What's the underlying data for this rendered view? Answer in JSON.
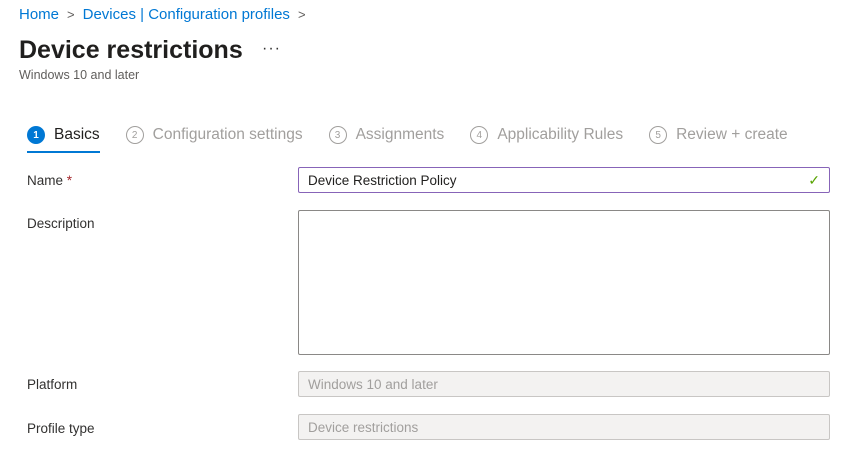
{
  "breadcrumb": {
    "home": "Home",
    "devices": "Devices | Configuration profiles",
    "sep": ">"
  },
  "header": {
    "title": "Device restrictions",
    "more": "···",
    "subtitle": "Windows 10 and later"
  },
  "steps": [
    {
      "num": "1",
      "label": "Basics"
    },
    {
      "num": "2",
      "label": "Configuration settings"
    },
    {
      "num": "3",
      "label": "Assignments"
    },
    {
      "num": "4",
      "label": "Applicability Rules"
    },
    {
      "num": "5",
      "label": "Review + create"
    }
  ],
  "form": {
    "name_label": "Name",
    "required": "*",
    "name_value": "Device Restriction Policy",
    "check": "✓",
    "description_label": "Description",
    "description_value": "",
    "platform_label": "Platform",
    "platform_value": "Windows 10 and later",
    "profile_label": "Profile type",
    "profile_value": "Device restrictions"
  }
}
